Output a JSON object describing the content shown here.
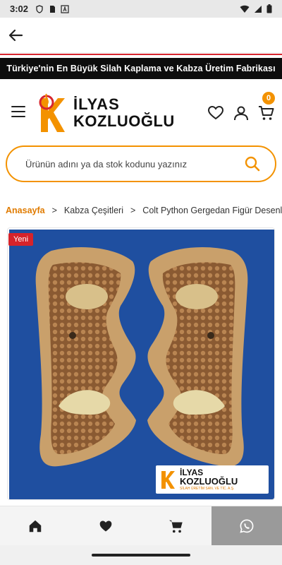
{
  "status": {
    "time": "3:02"
  },
  "banner": {
    "text": "Türkiye'nin En Büyük Silah Kaplama ve Kabza Üretim Fabrikası"
  },
  "logo": {
    "line1": "İLYAS",
    "line2": "KOZLUOĞLU"
  },
  "cart": {
    "count": "0"
  },
  "search": {
    "placeholder": "Ürünün adını ya da stok kodunu yazınız"
  },
  "breadcrumb": {
    "home": "Anasayfa",
    "sep": ">",
    "category": "Kabza Çeşitleri",
    "current": "Colt Python Gergedan Figür Desenli Ce"
  },
  "product": {
    "badge": "Yeni"
  },
  "watermark": {
    "line1": "İLYAS",
    "line2": "KOZLUOĞLU",
    "line3": "SİLAH ÜRETİM SAN. VE TİC. A.Ş."
  },
  "colors": {
    "accent": "#f39200",
    "brand_red": "#d7262e",
    "banner_bg": "#0d0d0d",
    "photo_bg": "#1f4fa0"
  },
  "icons": [
    "back-arrow-icon",
    "menu-icon",
    "heart-icon",
    "user-icon",
    "cart-icon",
    "search-icon",
    "home-icon",
    "whatsapp-icon"
  ]
}
